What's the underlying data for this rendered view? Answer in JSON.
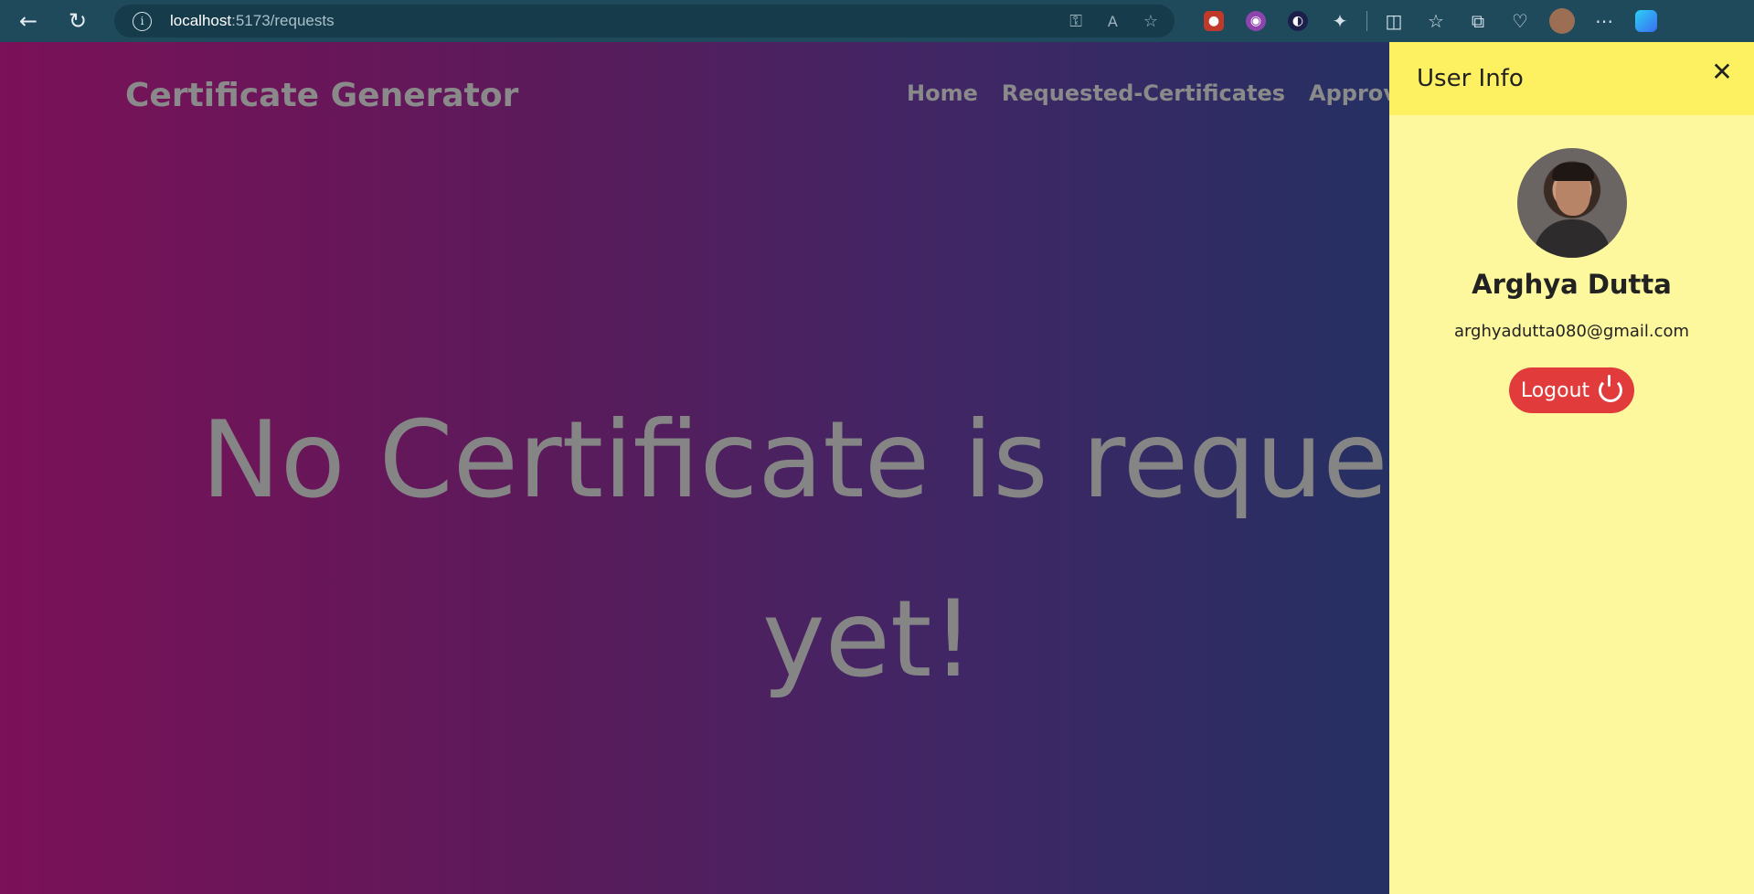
{
  "browser": {
    "url_host": "localhost",
    "url_path": ":5173/requests",
    "icons": [
      "back-icon",
      "refresh-icon",
      "info-icon",
      "key-icon",
      "read-aloud-icon",
      "favorite-icon",
      "extension-icon",
      "split-screen-icon",
      "favorites-icon",
      "collections-icon",
      "health-icon",
      "profile-icon",
      "more-icon",
      "copilot-icon"
    ]
  },
  "app": {
    "brand": "Certificate Generator",
    "nav": [
      "Home",
      "Requested-Certificates",
      "Approved-C"
    ],
    "empty_message_line1": "No Certificate is request",
    "empty_message_line2": "yet!"
  },
  "drawer": {
    "title": "User Info",
    "close_symbol": "✕",
    "user_name": "Arghya Dutta",
    "user_email": "arghyadutta080@gmail.com",
    "logout_label": "Logout"
  },
  "colors": {
    "gradient_left": "#7b1158",
    "gradient_right": "#253063",
    "drawer_bg": "#fdf79e",
    "drawer_header_bg": "#fef161",
    "logout_bg": "#e23b3b"
  }
}
